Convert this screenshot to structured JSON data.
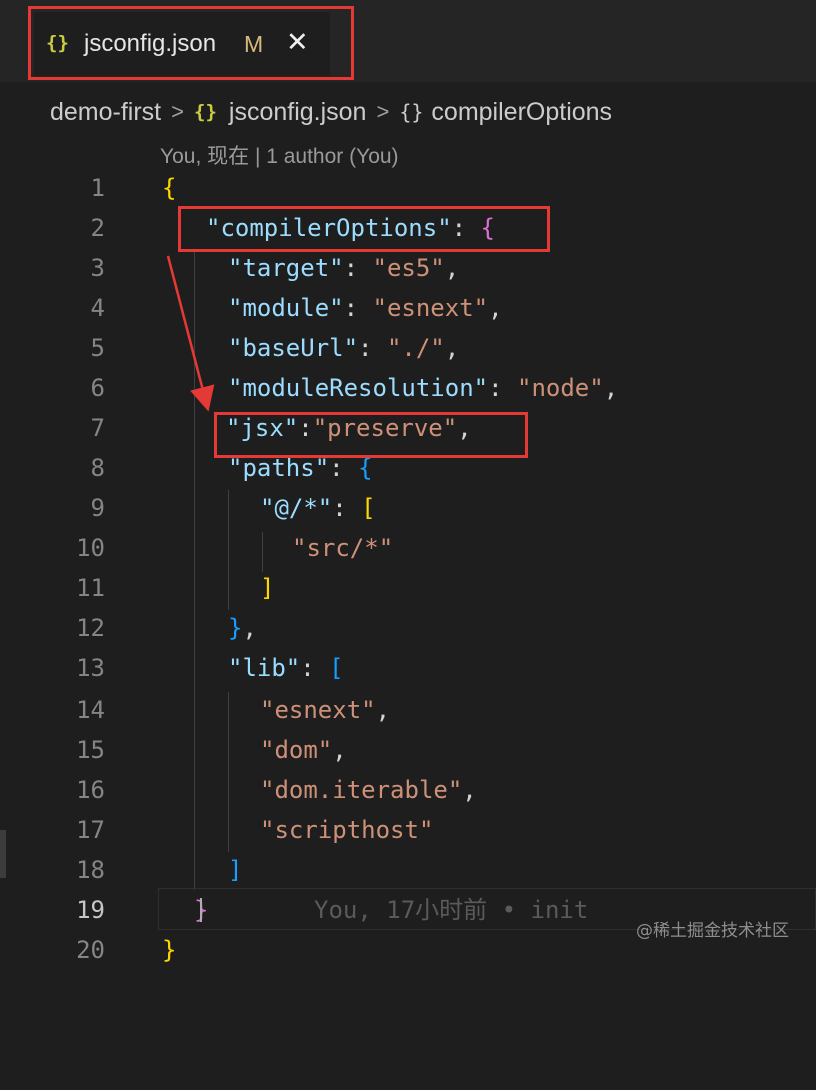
{
  "tab": {
    "icon": "{}",
    "title": "jsconfig.json",
    "modified_marker": "M",
    "close_glyph": "✕"
  },
  "breadcrumb": {
    "folder": "demo-first",
    "separator": ">",
    "file_icon": "{}",
    "file": "jsconfig.json",
    "symbol_icon": "{}",
    "symbol": "compilerOptions"
  },
  "codelens": {
    "text": "You, 现在 | 1 author (You)"
  },
  "lines": [
    {
      "n": "1"
    },
    {
      "n": "2"
    },
    {
      "n": "3"
    },
    {
      "n": "4"
    },
    {
      "n": "5"
    },
    {
      "n": "6"
    },
    {
      "n": "7"
    },
    {
      "n": "8"
    },
    {
      "n": "9"
    },
    {
      "n": "10"
    },
    {
      "n": "11"
    },
    {
      "n": "12"
    },
    {
      "n": "13"
    },
    {
      "n": "14"
    },
    {
      "n": "15"
    },
    {
      "n": "16"
    },
    {
      "n": "17"
    },
    {
      "n": "18"
    },
    {
      "n": "19"
    },
    {
      "n": "20"
    }
  ],
  "tokens": {
    "l1_open": "{",
    "l2_key": "\"compilerOptions\"",
    "l2_colon": ": ",
    "l2_open": "{",
    "l3_key": "\"target\"",
    "l3_colon": ": ",
    "l3_val": "\"es5\"",
    "l3_comma": ",",
    "l4_key": "\"module\"",
    "l4_colon": ": ",
    "l4_val": "\"esnext\"",
    "l4_comma": ",",
    "l5_key": "\"baseUrl\"",
    "l5_colon": ": ",
    "l5_val": "\"./\"",
    "l5_comma": ",",
    "l6_key": "\"moduleResolution\"",
    "l6_colon": ": ",
    "l6_val": "\"node\"",
    "l6_comma": ",",
    "l7_key": "\"jsx\"",
    "l7_colon": ":",
    "l7_val": "\"preserve\"",
    "l7_comma": ",",
    "l8_key": "\"paths\"",
    "l8_colon": ": ",
    "l8_open": "{",
    "l9_key": "\"@/*\"",
    "l9_colon": ": ",
    "l9_open": "[",
    "l10_val": "\"src/*\"",
    "l11_close": "]",
    "l12_close": "}",
    "l12_comma": ",",
    "l13_key": "\"lib\"",
    "l13_colon": ": ",
    "l13_open": "[",
    "l14_val": "\"esnext\"",
    "l14_comma": ",",
    "l15_val": "\"dom\"",
    "l15_comma": ",",
    "l16_val": "\"dom.iterable\"",
    "l16_comma": ",",
    "l17_val": "\"scripthost\"",
    "l18_close": "]",
    "l19_close": "}",
    "l19_blame": "You, 17小时前 • init",
    "l20_close": "}"
  },
  "watermark": "@稀土掘金技术社区",
  "colors": {
    "background": "#1e1e1e",
    "key": "#9cdcfe",
    "string": "#ce9178",
    "bracket_gold": "#ffd700",
    "bracket_purple": "#da70d6",
    "bracket_blue": "#179fff",
    "annotation_red": "#e53935"
  },
  "icons": {
    "tab": "json-braces-icon",
    "close": "close-icon",
    "breadcrumb_sep": "chevron-right-icon"
  }
}
